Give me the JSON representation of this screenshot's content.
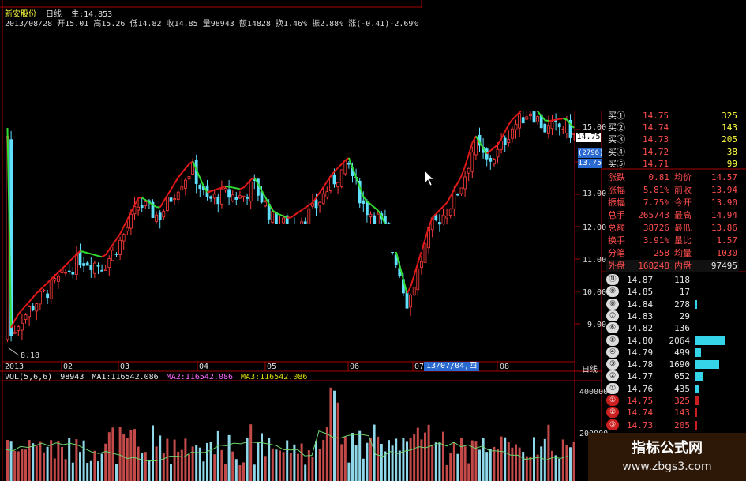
{
  "header": {
    "stock_name": "新安股份",
    "period": "日线",
    "price_label": "生:14.853",
    "info_line": "2013/08/28 开15.01 高15.26 低14.82 收14.85 量98943 额14828 换1.46% 振2.88% 涨(-0.41)-2.69%"
  },
  "price_axis": {
    "labels": [
      "15.00",
      "14.75",
      "13.75",
      "13.00",
      "12.00",
      "11.00",
      "10.00",
      "9.00"
    ],
    "current_price_tag": "14.75",
    "cursor_value_tag": "(2796)",
    "low_marker": "8.18"
  },
  "time_axis": {
    "labels": [
      "2013",
      "02",
      "03",
      "04",
      "05",
      "06",
      "07",
      "08"
    ],
    "cursor_date": "13/07/04,四",
    "period_label": "日线"
  },
  "volume_header": {
    "indicator": "VOL(5,6,6)",
    "vol": "98943",
    "ma1": "MA1:116542.086",
    "ma2": "MA2:116542.086",
    "ma3": "MA3:116542.086"
  },
  "volume_axis": [
    "400000",
    "200000"
  ],
  "order_book_buy": [
    {
      "label": "买①",
      "price": "14.75",
      "volume": "325"
    },
    {
      "label": "买②",
      "price": "14.74",
      "volume": "143"
    },
    {
      "label": "买③",
      "price": "14.73",
      "volume": "205"
    },
    {
      "label": "买④",
      "price": "14.72",
      "volume": "38"
    },
    {
      "label": "买⑤",
      "price": "14.71",
      "volume": "99"
    }
  ],
  "quote_stats": [
    {
      "k1": "涨跌",
      "v1": "0.81",
      "k2": "均价",
      "v2": "14.57"
    },
    {
      "k1": "涨幅",
      "v1": "5.81%",
      "k2": "前收",
      "v2": "13.94"
    },
    {
      "k1": "振幅",
      "v1": "7.75%",
      "k2": "今开",
      "v2": "13.90"
    },
    {
      "k1": "总手",
      "v1": "265743",
      "k2": "最高",
      "v2": "14.94"
    },
    {
      "k1": "总额",
      "v1": "38726",
      "k2": "最低",
      "v2": "13.86"
    },
    {
      "k1": "换手",
      "v1": "3.91%",
      "k2": "量比",
      "v2": "1.57"
    },
    {
      "k1": "分笔",
      "v1": "258",
      "k2": "均量",
      "v2": "1030"
    },
    {
      "k1": "外盘",
      "v1": "168248",
      "k2": "内盘",
      "v2": "97495"
    }
  ],
  "tick_list": [
    {
      "n": "⑪",
      "price": "14.87",
      "vol": "118",
      "bar": 0.0
    },
    {
      "n": "⑨",
      "price": "14.85",
      "vol": "17",
      "bar": 0.0
    },
    {
      "n": "⑧",
      "price": "14.84",
      "vol": "278",
      "bar": 0.06
    },
    {
      "n": "⑦",
      "price": "14.83",
      "vol": "29",
      "bar": 0.0
    },
    {
      "n": "⑥",
      "price": "14.82",
      "vol": "136",
      "bar": 0.0
    },
    {
      "n": "⑤",
      "price": "14.80",
      "vol": "2064",
      "bar": 1.0
    },
    {
      "n": "④",
      "price": "14.79",
      "vol": "499",
      "bar": 0.2
    },
    {
      "n": "③",
      "price": "14.78",
      "vol": "1690",
      "bar": 0.82
    },
    {
      "n": "②",
      "price": "14.77",
      "vol": "652",
      "bar": 0.3
    },
    {
      "n": "①",
      "price": "14.76",
      "vol": "435",
      "bar": 0.17
    },
    {
      "n": "①",
      "price": "14.75",
      "vol": "325",
      "bar": 0.14,
      "sell": true
    },
    {
      "n": "②",
      "price": "14.74",
      "vol": "143",
      "bar": 0.06,
      "sell": true
    },
    {
      "n": "③",
      "price": "14.73",
      "vol": "205",
      "bar": 0.08,
      "sell": true
    }
  ],
  "watermark": {
    "title": "指标公式网",
    "url": "www.zbgs3.com"
  },
  "colors": {
    "up": "#ff3b3b",
    "down": "#5fe0ff",
    "ma_line": "#33dd33",
    "ma_red": "#e01818",
    "grid": "#8a0000"
  }
}
